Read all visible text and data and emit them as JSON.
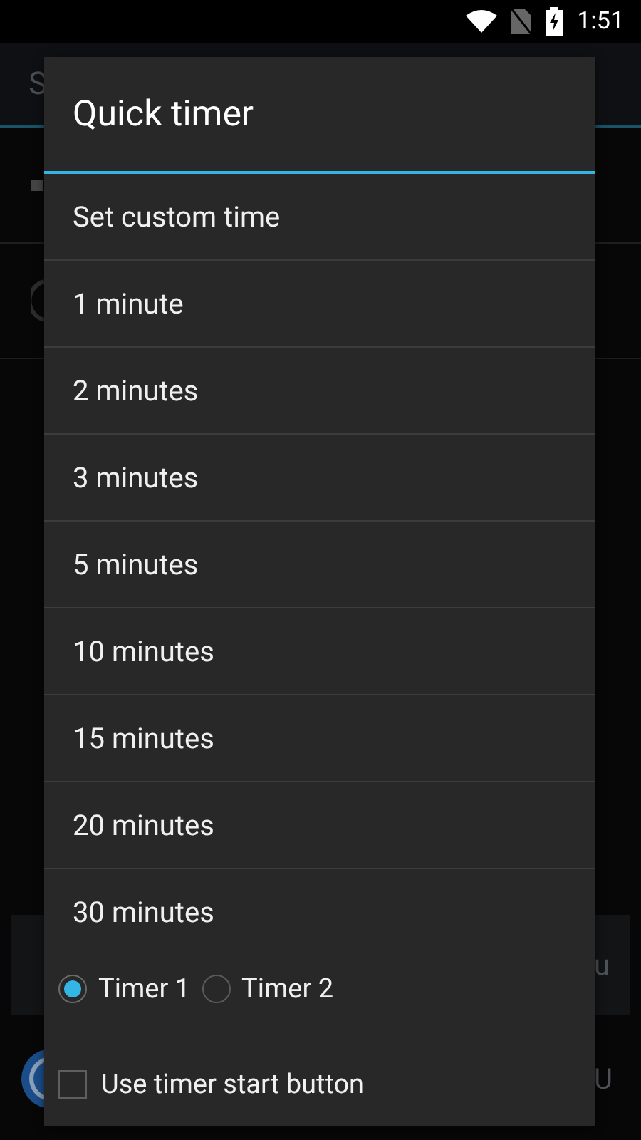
{
  "status_bar": {
    "time": "1:51"
  },
  "background": {
    "title": "S",
    "row_texts": [
      "u",
      "U"
    ]
  },
  "dialog": {
    "title": "Quick timer",
    "items": [
      "Set custom time",
      "1 minute",
      "2 minutes",
      "3 minutes",
      "5 minutes",
      "10 minutes",
      "15 minutes",
      "20 minutes",
      "30 minutes"
    ],
    "timers": [
      {
        "label": "Timer 1",
        "selected": true
      },
      {
        "label": "Timer 2",
        "selected": false
      }
    ],
    "start_button_option": {
      "label": "Use timer start button",
      "checked": false
    }
  }
}
